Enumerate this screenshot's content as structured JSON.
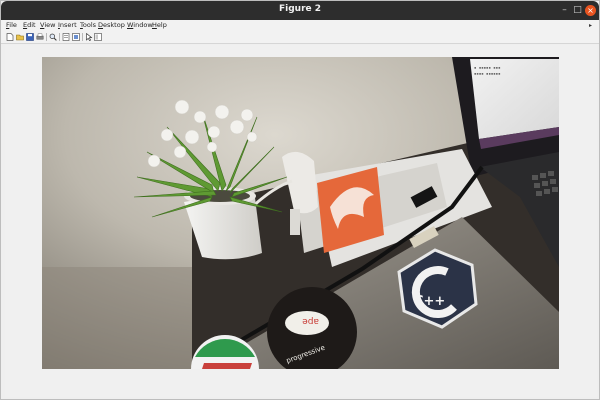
{
  "window": {
    "title": "Figure 2",
    "controls": {
      "minimize": "–",
      "maximize": "□",
      "close": "×"
    }
  },
  "menubar": {
    "items": [
      {
        "label": "File",
        "mnemonic": "F",
        "rest": "ile"
      },
      {
        "label": "Edit",
        "mnemonic": "E",
        "rest": "dit"
      },
      {
        "label": "View",
        "mnemonic": "V",
        "rest": "iew"
      },
      {
        "label": "Insert",
        "mnemonic": "I",
        "rest": "nsert"
      },
      {
        "label": "Tools",
        "mnemonic": "T",
        "rest": "ools"
      },
      {
        "label": "Desktop",
        "mnemonic": "D",
        "rest": "esktop"
      },
      {
        "label": "Window",
        "mnemonic": "W",
        "rest": "indow"
      },
      {
        "label": "Help",
        "mnemonic": "H",
        "rest": "elp"
      }
    ],
    "overflow_arrow": "▸"
  },
  "toolbar": {
    "icons": [
      "new-figure-icon",
      "open-file-icon",
      "save-icon",
      "print-icon",
      "zoom-icon",
      "link-plot-icon",
      "data-cursor-icon",
      "edit-plot-icon"
    ]
  },
  "photo": {
    "laptop_screen_text": "■ ■■■■■  ■■■\n■■■■  ■■■■■■\n■■■  ■■■■",
    "sticker_ape_text": "ape",
    "sticker_progress_text": "progressive",
    "sticker_cpp_text": "C++"
  }
}
